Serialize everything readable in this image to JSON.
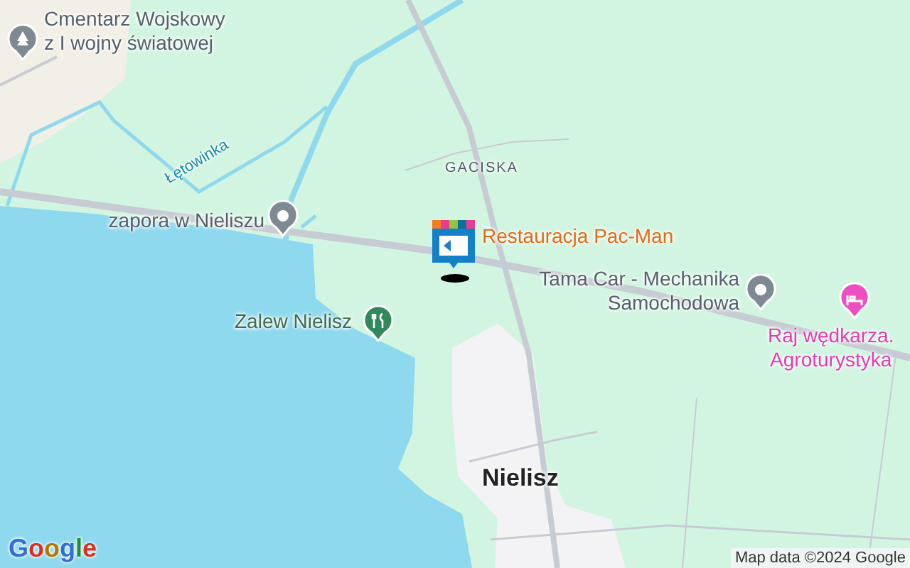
{
  "map": {
    "places": [
      {
        "kind": "cemetery",
        "lines": [
          "Cmentarz Wojskowy",
          "z I wojny światowej"
        ]
      },
      {
        "kind": "river",
        "lines": [
          "Łętowinka"
        ]
      },
      {
        "kind": "area",
        "lines": [
          "GACISKA"
        ]
      },
      {
        "kind": "poi",
        "lines": [
          "zapora w Nieliszu"
        ]
      },
      {
        "kind": "restaurant",
        "lines": [
          "Restauracja Pac-Man"
        ]
      },
      {
        "kind": "poi",
        "lines": [
          "Tama Car - Mechanika",
          "Samochodowa"
        ]
      },
      {
        "kind": "lodging",
        "lines": [
          "Raj wędkarza.",
          "Agroturystyka"
        ]
      },
      {
        "kind": "park",
        "lines": [
          "Zalew Nielisz"
        ]
      },
      {
        "kind": "town",
        "lines": [
          "Nielisz"
        ]
      }
    ],
    "logo": "Google",
    "attribution": "Map data ©2024 Google"
  }
}
